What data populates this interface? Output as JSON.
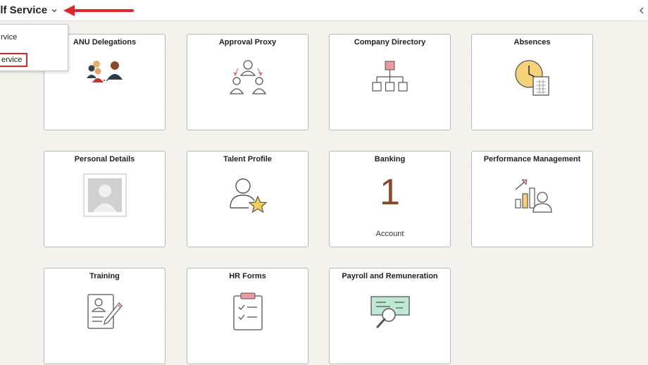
{
  "header": {
    "title": "elf Service",
    "chevron_icon": "chevron-down-icon",
    "collapse_icon": "chevron-left-icon"
  },
  "dropdown": {
    "items": [
      {
        "label": "rvice"
      },
      {
        "label": "ervice"
      }
    ]
  },
  "annotation": {
    "arrow_color": "#e0242c"
  },
  "tiles": [
    {
      "title": "ANU Delegations",
      "icon": "delegation-people-icon"
    },
    {
      "title": "Approval Proxy",
      "icon": "approval-proxy-icon"
    },
    {
      "title": "Company Directory",
      "icon": "org-chart-icon"
    },
    {
      "title": "Absences",
      "icon": "clock-calendar-icon"
    },
    {
      "title": "Personal Details",
      "icon": "profile-photo-icon"
    },
    {
      "title": "Talent Profile",
      "icon": "person-star-icon"
    },
    {
      "title": "Banking",
      "count": "1",
      "sub": "Account"
    },
    {
      "title": "Performance Management",
      "icon": "performance-chart-icon"
    },
    {
      "title": "Training",
      "icon": "training-form-pencil-icon"
    },
    {
      "title": "HR Forms",
      "icon": "clipboard-checklist-icon"
    },
    {
      "title": "Payroll and Remuneration",
      "icon": "cheque-magnifier-icon"
    }
  ]
}
